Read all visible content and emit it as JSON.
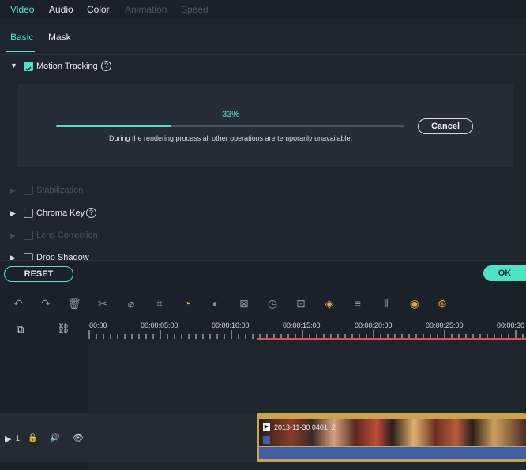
{
  "tabs": [
    {
      "label": "Video"
    },
    {
      "label": "Audio"
    },
    {
      "label": "Color"
    },
    {
      "label": "Animation"
    },
    {
      "label": "Speed"
    }
  ],
  "subtabs": [
    {
      "label": "Basic"
    },
    {
      "label": "Mask"
    }
  ],
  "options": {
    "motion_tracking": {
      "label": "Motion Tracking",
      "help": "?"
    },
    "stabilization": {
      "label": "Stabilization"
    },
    "chroma_key": {
      "label": "Chroma Key",
      "help": "?"
    },
    "lens_correction": {
      "label": "Lens Correction"
    },
    "drop_shadow": {
      "label": "Drop Shadow"
    }
  },
  "render": {
    "percent": "33%",
    "progress": 0.33,
    "note": "During the rendering process all other operations are temporarily unavailable.",
    "cancel_label": "Cancel"
  },
  "actions": {
    "reset_label": "RESET",
    "ok_label": "OK"
  },
  "toolbar_icons": [
    "undo-icon",
    "redo-icon",
    "delete-icon",
    "cut-icon",
    "tag-icon",
    "crop-icon",
    "speed-icon",
    "color-icon",
    "title-icon",
    "duration-icon",
    "freeze-icon",
    "keyframe-icon",
    "adjust-icon",
    "split-audio-icon",
    "audio-icon",
    "voiceover-icon"
  ],
  "ruler": {
    "ticks": [
      "00:00",
      "00:00:05:00",
      "00:00:10:00",
      "00:00:15:00",
      "00:00:20:00",
      "00:00:25:00",
      "00:00:30"
    ]
  },
  "track": {
    "number": "1",
    "clip_title": "2013-11-30 0401_2"
  },
  "colors": {
    "accent": "#4de3c4",
    "highlight": "#e2a93b"
  }
}
